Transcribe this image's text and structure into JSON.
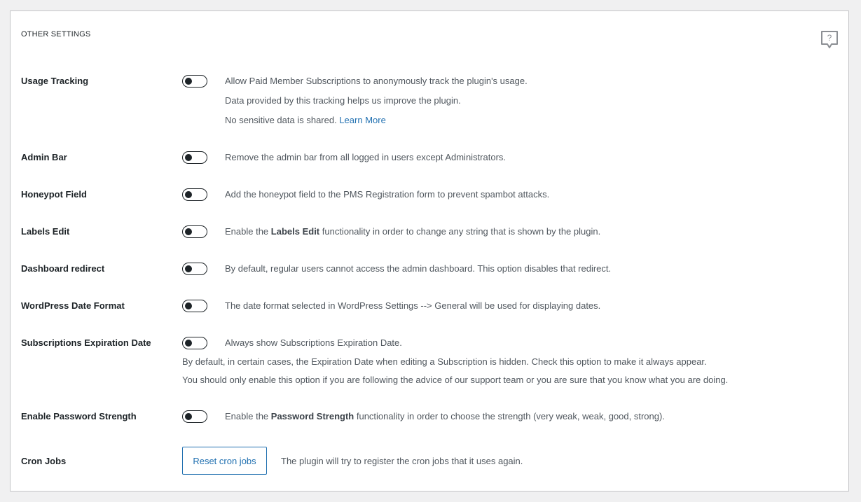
{
  "section": {
    "title": "OTHER SETTINGS",
    "help_glyph": "?"
  },
  "settings": {
    "usage_tracking": {
      "label": "Usage Tracking",
      "enabled": false,
      "line1": "Allow Paid Member Subscriptions to anonymously track the plugin's usage.",
      "line2": "Data provided by this tracking helps us improve the plugin.",
      "line3": "No sensitive data is shared.",
      "learn_more": "Learn More"
    },
    "admin_bar": {
      "label": "Admin Bar",
      "enabled": false,
      "description": "Remove the admin bar from all logged in users except Administrators."
    },
    "honeypot_field": {
      "label": "Honeypot Field",
      "enabled": false,
      "description": "Add the honeypot field to the PMS Registration form to prevent spambot attacks."
    },
    "labels_edit": {
      "label": "Labels Edit",
      "enabled": false,
      "desc_before": "Enable the ",
      "desc_bold": "Labels Edit",
      "desc_after": " functionality in order to change any string that is shown by the plugin."
    },
    "dashboard_redirect": {
      "label": "Dashboard redirect",
      "enabled": false,
      "description": "By default, regular users cannot access the admin dashboard. This option disables that redirect."
    },
    "wordpress_date_format": {
      "label": "WordPress Date Format",
      "enabled": false,
      "description": "The date format selected in WordPress Settings --> General will be used for displaying dates."
    },
    "subscriptions_expiration_date": {
      "label": "Subscriptions Expiration Date",
      "enabled": false,
      "description": "Always show Subscriptions Expiration Date.",
      "note1": "By default, in certain cases, the Expiration Date when editing a Subscription is hidden. Check this option to make it always appear.",
      "note2": "You should only enable this option if you are following the advice of our support team or you are sure that you know what you are doing."
    },
    "password_strength": {
      "label": "Enable Password Strength",
      "enabled": false,
      "desc_before": "Enable the ",
      "desc_bold": "Password Strength",
      "desc_after": " functionality in order to choose the strength (very weak, weak, good, strong)."
    },
    "cron_jobs": {
      "label": "Cron Jobs",
      "button_label": "Reset cron jobs",
      "description": "The plugin will try to register the cron jobs that it uses again."
    }
  }
}
